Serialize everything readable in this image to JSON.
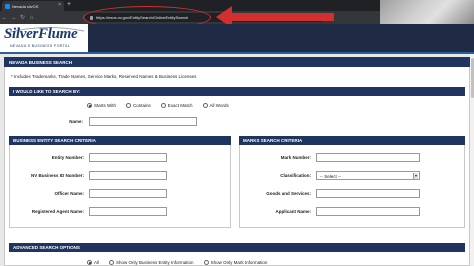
{
  "browser": {
    "tab_title": "Nevada silvOS",
    "url": "https://esos.nv.gov/EntitySearch/OnlineEntitySearch",
    "annotation_color": "#d32f2f"
  },
  "site": {
    "logo_text": "SilverFlume",
    "logo_subtitle": "NEVADA'S BUSINESS PORTAL",
    "brand_color": "#1a3a6b",
    "header_color": "#1f2a44"
  },
  "page": {
    "title": "NEVADA BUSINESS SEARCH",
    "includes_note": "* Includes Trademarks, Trade Names, Service Marks, Reserved Names & Business Licenses",
    "search_section": "I WOULD LIKE TO SEARCH BY:",
    "match_options": [
      "Starts With",
      "Contains",
      "Exact Match",
      "All Words"
    ],
    "selected_match": "Starts With",
    "name_label": "Name:",
    "entity_section": {
      "title": "BUSINESS ENTITY SEARCH CRITERIA",
      "fields": [
        "Entity Number:",
        "NV Business ID Number:",
        "Officer Name:",
        "Registered Agent Name:"
      ]
    },
    "marks_section": {
      "title": "MARKS SEARCH CRITERIA",
      "mark_number_label": "Mark Number:",
      "classification_label": "Classification:",
      "classification_value": "-- Select --",
      "goods_label": "Goods and Services:",
      "applicant_label": "Applicant Name:"
    },
    "advanced_section": "ADVANCED SEARCH OPTIONS",
    "advanced_options": [
      "All",
      "Show Only Business Entity Information",
      "Show Only Mark Information"
    ],
    "selected_advanced": "All"
  }
}
